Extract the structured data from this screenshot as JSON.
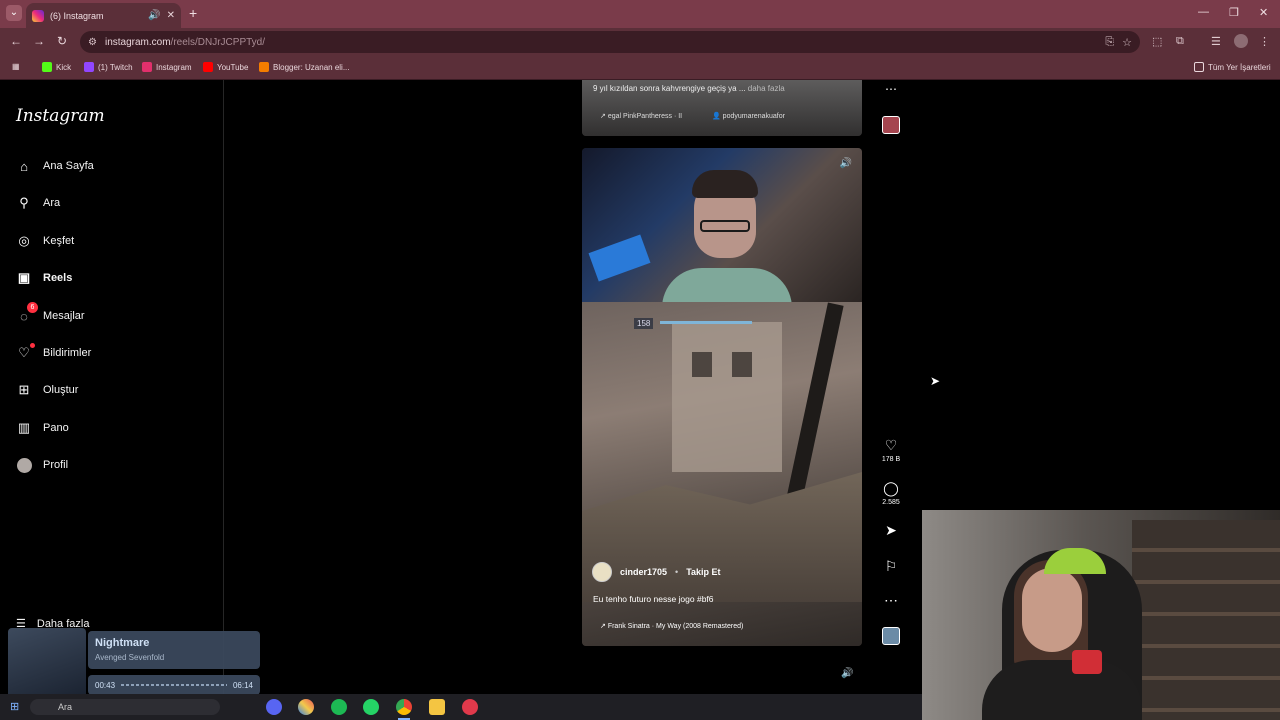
{
  "browser": {
    "tab_title": "(6) Instagram",
    "url_host": "instagram.com",
    "url_path": "/reels/DNJrJCPPTyd/",
    "bookmarks": [
      {
        "label": "Kick",
        "color": "#53fc18"
      },
      {
        "label": "(1) Twitch",
        "color": "#9146ff"
      },
      {
        "label": "Instagram",
        "color": "#e1306c"
      },
      {
        "label": "YouTube",
        "color": "#ff0000"
      },
      {
        "label": "Blogger: Uzanan eli...",
        "color": "#f57d00"
      }
    ],
    "all_bookmarks": "Tüm Yer İşaretleri"
  },
  "sidebar": {
    "logo": "Instagram",
    "items": [
      {
        "label": "Ana Sayfa",
        "icon": "home-icon"
      },
      {
        "label": "Ara",
        "icon": "search-icon"
      },
      {
        "label": "Keşfet",
        "icon": "compass-icon"
      },
      {
        "label": "Reels",
        "icon": "reels-icon"
      },
      {
        "label": "Mesajlar",
        "icon": "messenger-icon",
        "badge": "6"
      },
      {
        "label": "Bildirimler",
        "icon": "heart-icon"
      },
      {
        "label": "Oluştur",
        "icon": "plus-icon"
      },
      {
        "label": "Pano",
        "icon": "dashboard-icon"
      },
      {
        "label": "Profil",
        "icon": "avatar"
      }
    ],
    "more": "Daha fazla"
  },
  "prev_reel": {
    "caption": "9 yıl kızıldan sonra kahvrengiye geçiş ya ...",
    "more": "daha fazla",
    "audio": "egal  PinkPantheress · II",
    "location": "podyumarenakuafor"
  },
  "reel": {
    "hud_number": "158",
    "username": "cinder1705",
    "separator": "•",
    "follow": "Takip Et",
    "caption": "Eu tenho futuro nesse jogo #bf6",
    "audio": "Frank Sinatra · My Way (2008 Remastered)"
  },
  "actions": {
    "likes": "178 B",
    "comments": "2.585"
  },
  "now_playing": {
    "title": "Nightmare",
    "artist": "Avenged Sevenfold",
    "elapsed": "00:43",
    "duration": "06:14"
  },
  "taskbar": {
    "search": "Ara"
  }
}
